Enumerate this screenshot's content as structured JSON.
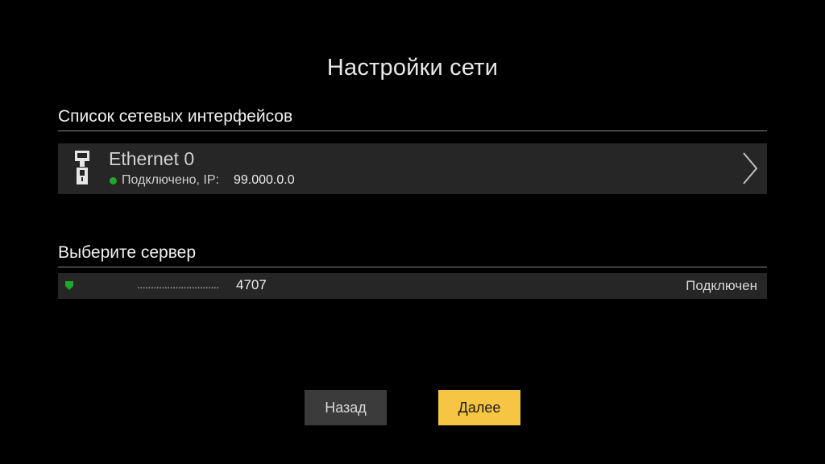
{
  "page": {
    "title": "Настройки сети"
  },
  "interfaces": {
    "header": "Список сетевых интерфейсов",
    "items": [
      {
        "name": "Ethernet 0",
        "status_label": "Подключено, IP:",
        "ip": "99.000.0.0",
        "icon": "ethernet-port-icon",
        "status_color": "#1fa82a"
      }
    ]
  },
  "server": {
    "header": "Выберите сервер",
    "items": [
      {
        "dots": "..............................",
        "port": "4707",
        "status": "Подключен",
        "status_color": "#1fa82a"
      }
    ]
  },
  "buttons": {
    "back_label": "Назад",
    "next_label": "Далее"
  },
  "colors": {
    "background": "#000000",
    "row_background": "#262626",
    "accent": "#f6c544",
    "connected": "#1fa82a"
  }
}
